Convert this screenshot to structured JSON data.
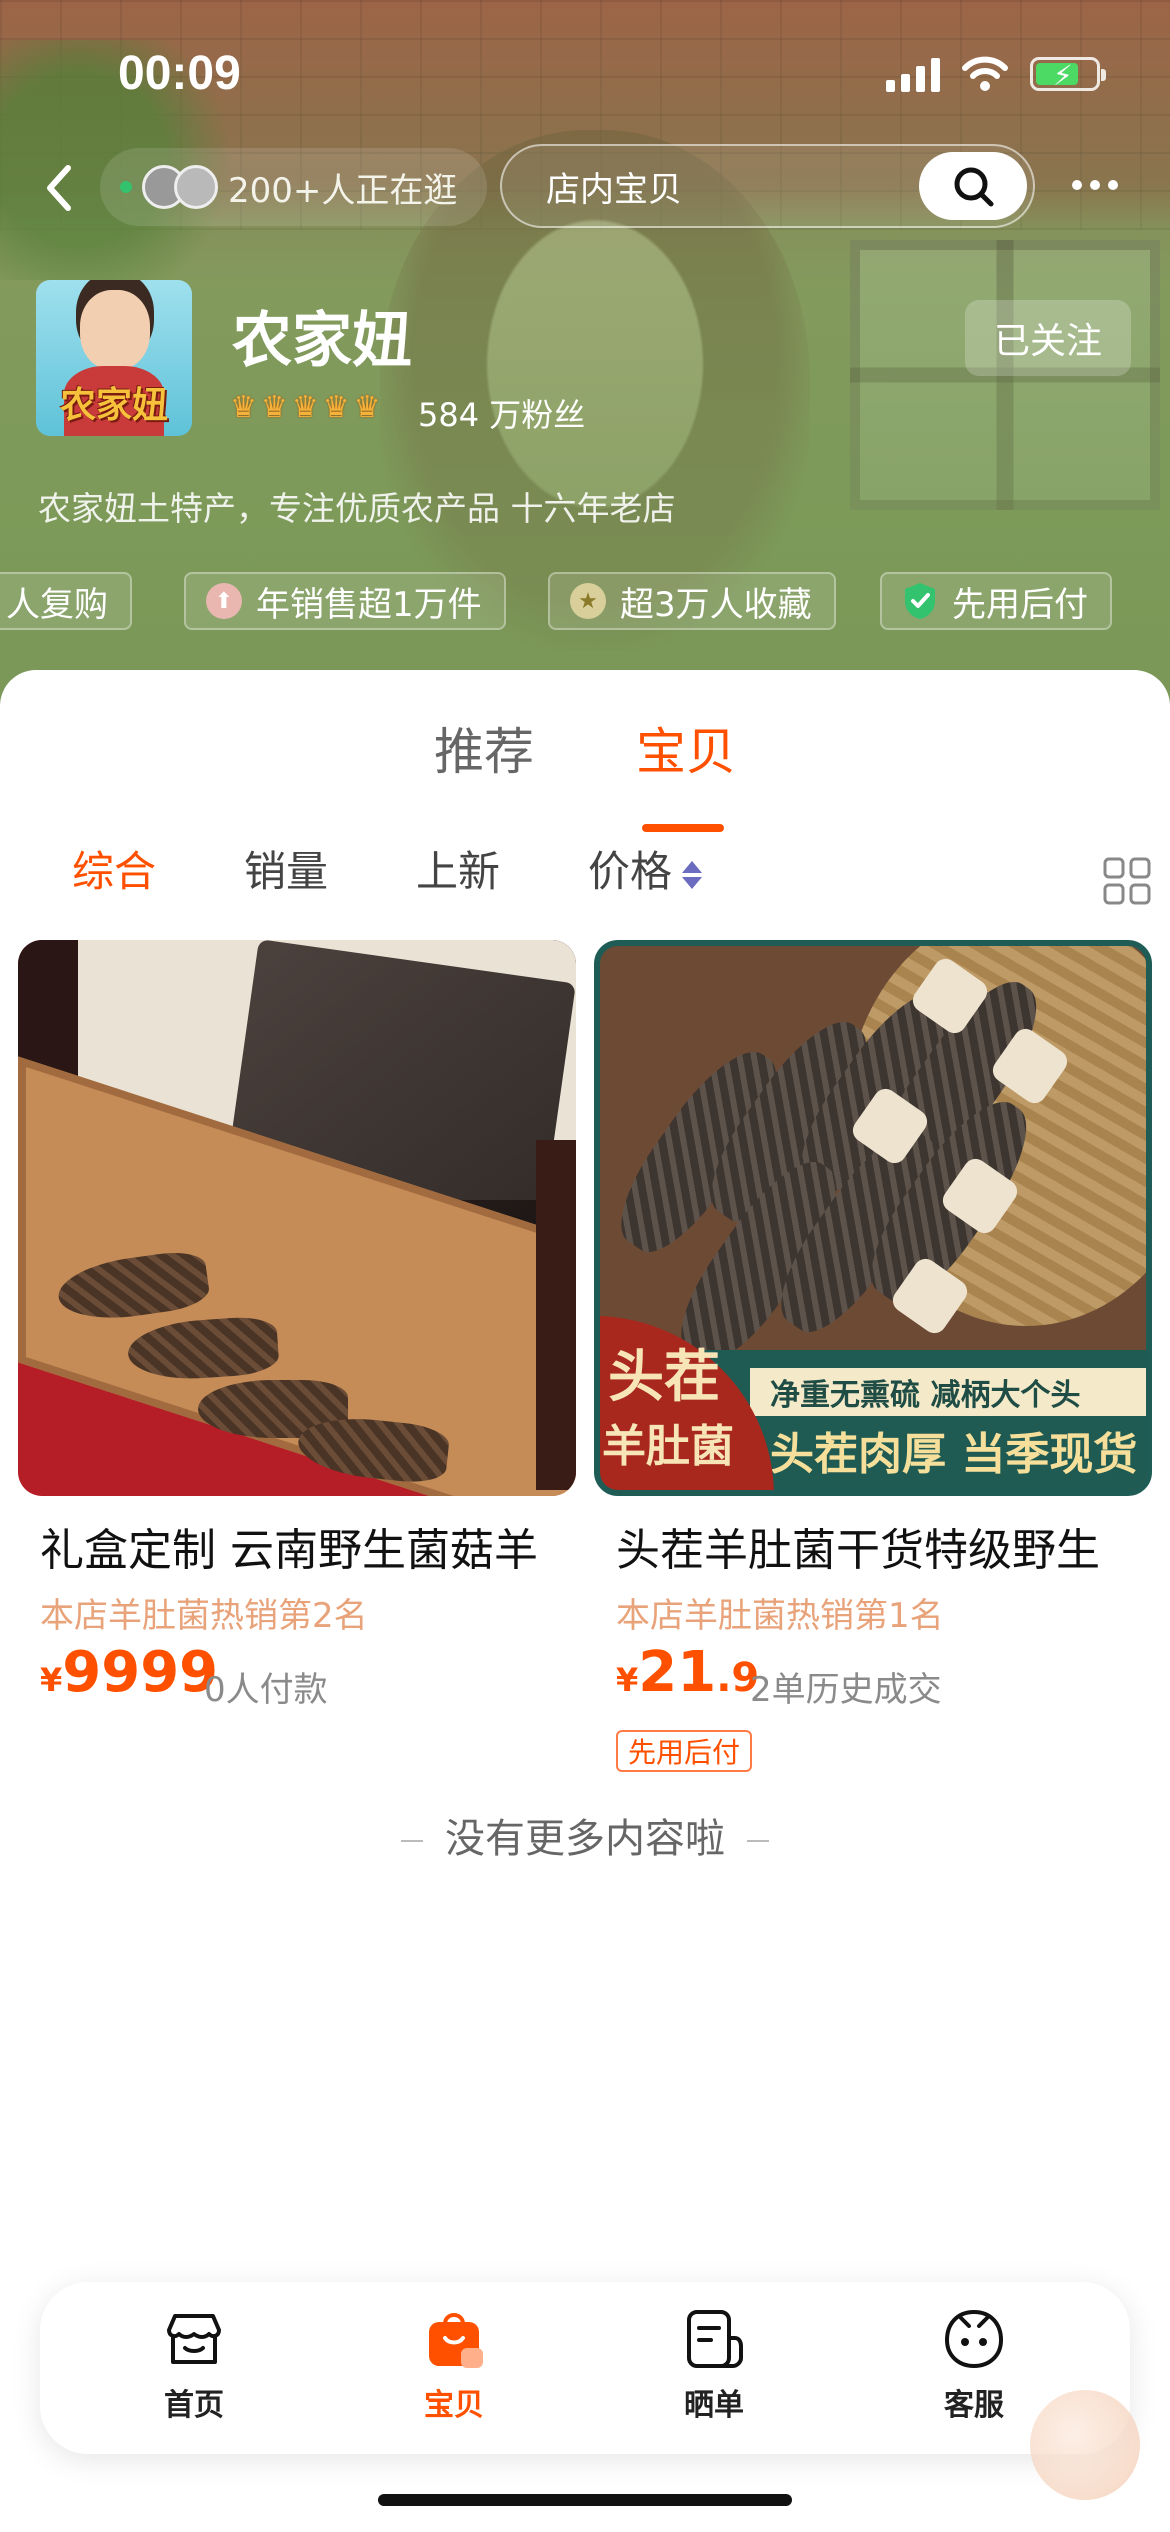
{
  "status": {
    "time": "00:09"
  },
  "nav": {
    "visitors_text": "200+人正在逛",
    "search_placeholder": "店内宝贝"
  },
  "shop": {
    "logo_text": "农家妞",
    "name": "农家妞",
    "crown_count": 5,
    "fans": "584 万粉丝",
    "follow_label": "已关注",
    "description": "农家妞土特产，专注优质农产品 十六年老店"
  },
  "badges": [
    {
      "label": "人复购",
      "icon": "repeat-icon"
    },
    {
      "label": "年销售超1万件",
      "icon": "arrow-up-icon"
    },
    {
      "label": "超3万人收藏",
      "icon": "star-icon"
    },
    {
      "label": "先用后付",
      "icon": "shield-check-icon"
    }
  ],
  "tabs": [
    {
      "label": "推荐",
      "active": false
    },
    {
      "label": "宝贝",
      "active": true
    }
  ],
  "sorts": [
    {
      "label": "综合",
      "active": true
    },
    {
      "label": "销量",
      "active": false
    },
    {
      "label": "上新",
      "active": false
    },
    {
      "label": "价格",
      "active": false
    }
  ],
  "products": [
    {
      "title": "礼盒定制 云南野生菌菇羊",
      "rank": "本店羊肚菌热销第2名",
      "currency": "¥",
      "price_int": "9999",
      "price_dec": "",
      "sold": "0人付款",
      "tag": ""
    },
    {
      "title": "头茬羊肚菌干货特级野生",
      "rank": "本店羊肚菌热销第1名",
      "currency": "¥",
      "price_int": "21",
      "price_dec": ".9",
      "sold": "2单历史成交",
      "tag": "先用后付",
      "image_text": {
        "seal_line1": "头茬",
        "seal_line2": "羊肚菌",
        "banner_top": "净重无熏硫  减柄大个头",
        "banner_bottom": "头茬肉厚 当季现货"
      }
    }
  ],
  "no_more": "没有更多内容啦",
  "tabbar": [
    {
      "label": "首页",
      "icon": "shop-icon",
      "active": false
    },
    {
      "label": "宝贝",
      "icon": "bag-icon",
      "active": true
    },
    {
      "label": "晒单",
      "icon": "review-icon",
      "active": false
    },
    {
      "label": "客服",
      "icon": "service-icon",
      "active": false
    }
  ],
  "colors": {
    "accent": "#ff5000",
    "header_green": "#7f9a5a"
  }
}
